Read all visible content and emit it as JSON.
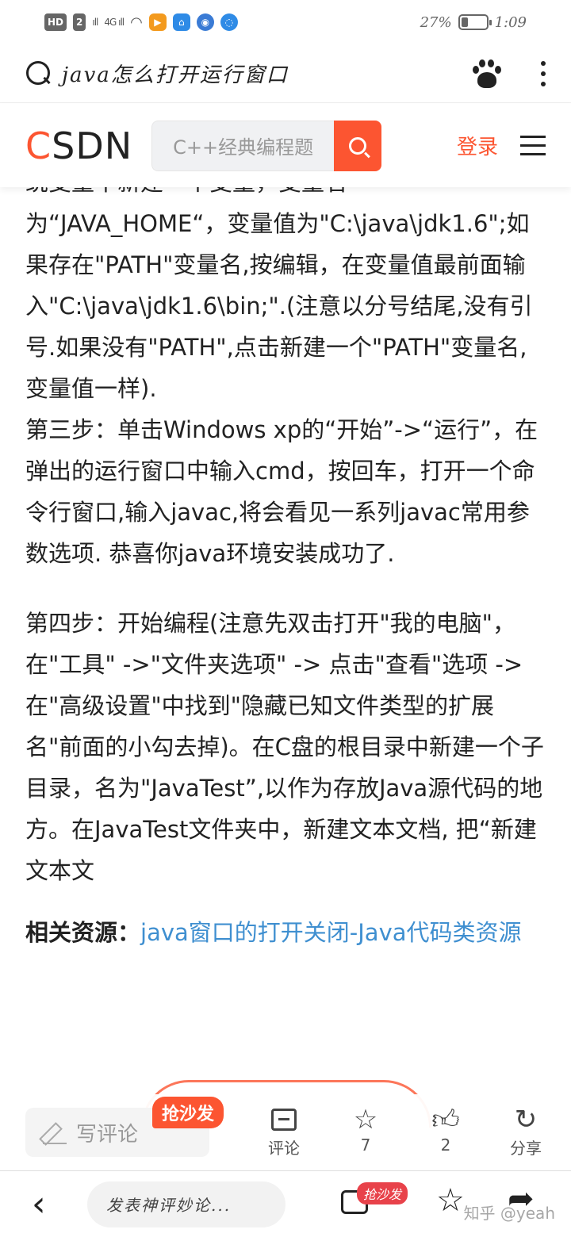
{
  "status_bar": {
    "hd_label": "HD",
    "sim": "2",
    "signal_1": "ıll",
    "signal_2": "4G ıll",
    "battery_text": "27%",
    "battery_level_pct": 27,
    "time": "1:09"
  },
  "browser": {
    "search_query": "java怎么打开运行窗口"
  },
  "csdn": {
    "logo_c": "C",
    "logo_rest": "SDN",
    "search_placeholder": "C++经典编程题",
    "login_label": "登录"
  },
  "article": {
    "para1": "统变量中新建一个变量，变量名为“JAVA_HOME“，变量值为\"C:\\java\\jdk1.6\";如果存在\"PATH\"变量名,按编辑，在变量值最前面输入\"C:\\java\\jdk1.6\\bin;\".(注意以分号结尾,没有引号.如果没有\"PATH\",点击新建一个\"PATH\"变量名,变量值一样).",
    "para2": "第三步：单击Windows xp的“开始”->“运行”，在弹出的运行窗口中输入cmd，按回车，打开一个命令行窗口,输入javac,将会看见一系列javac常用参数选项. 恭喜你java环境安装成功了.",
    "para3": "第四步：开始编程(注意先双击打开\"我的电脑\"，在\"工具\" ->\"文件夹选项\" -> 点击\"查看\"选项 ->在\"高级设置\"中找到\"隐藏已知文件类型的扩展名\"前面的小勾去掉)。在C盘的根目录中新建一个子目录，名为\"JavaTest”,以作为存放Java源代码的地方。在JavaTest文件夹中，新建文本文档, 把“新建 文本文",
    "related_label": "相关资源：",
    "related_link": "java窗口的打开关闭-Java代码类资源"
  },
  "comment_bar": {
    "write_placeholder": "写评论",
    "sofa_badge": "抢沙发",
    "comment_label": "评论",
    "star_count": "7",
    "like_count": "2",
    "share_label": "分享"
  },
  "bottom_bar": {
    "input_placeholder": "发表神评妙论...",
    "sofa_badge": "抢沙发"
  },
  "watermark": "知乎 @yeah",
  "colors": {
    "csdn_accent": "#fc5531",
    "link": "#3f8fd0"
  },
  "icons": [
    "search-icon",
    "baidu-paw-icon",
    "more-vertical-icon",
    "csdn-search-icon",
    "menu-icon",
    "pencil-icon",
    "comment-icon",
    "star-icon",
    "thumbs-up-icon",
    "share-icon",
    "back-icon"
  ]
}
